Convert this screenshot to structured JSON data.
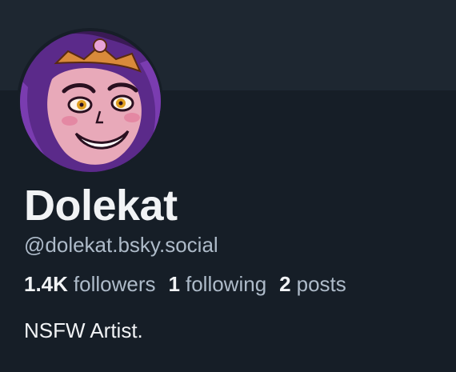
{
  "profile": {
    "display_name": "Dolekat",
    "handle": "@dolekat.bsky.social",
    "bio": "NSFW Artist."
  },
  "stats": {
    "followers_count": "1.4K",
    "followers_label": "followers",
    "following_count": "1",
    "following_label": "following",
    "posts_count": "2",
    "posts_label": "posts"
  },
  "colors": {
    "banner": "#1e2731",
    "background": "#161e27",
    "primary_text": "#f1f3f5",
    "secondary_text": "#aebbc9"
  },
  "avatar": {
    "icon": "avatar-illustration-icon"
  }
}
